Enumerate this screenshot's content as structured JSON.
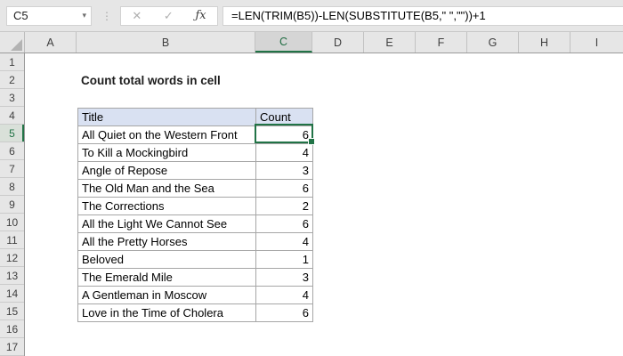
{
  "topbar": {
    "name_box": "C5",
    "formula": "=LEN(TRIM(B5))-LEN(SUBSTITUTE(B5,\" \",\"\"))+1",
    "icons": {
      "dropdown": "▾",
      "dots": "⋮",
      "cancel": "✕",
      "enter": "✓",
      "fx": "ƒx"
    }
  },
  "grid": {
    "columns": [
      "A",
      "B",
      "C",
      "D",
      "E",
      "F",
      "G",
      "H",
      "I"
    ],
    "rows": [
      "1",
      "2",
      "3",
      "4",
      "5",
      "6",
      "7",
      "8",
      "9",
      "10",
      "11",
      "12",
      "13",
      "14",
      "15",
      "16",
      "17"
    ],
    "selected_column": "C",
    "selected_row": "5",
    "selected_cell": "C5"
  },
  "sheet": {
    "title": "Count total words in cell",
    "table": {
      "headers": [
        "Title",
        "Count"
      ],
      "rows": [
        {
          "title": "All Quiet on the Western Front",
          "count": "6"
        },
        {
          "title": "To Kill a Mockingbird",
          "count": "4"
        },
        {
          "title": "Angle of Repose",
          "count": "3"
        },
        {
          "title": "The Old Man and the Sea",
          "count": "6"
        },
        {
          "title": "The Corrections",
          "count": "2"
        },
        {
          "title": "All the Light We Cannot See",
          "count": "6"
        },
        {
          "title": "All the Pretty Horses",
          "count": "4"
        },
        {
          "title": "Beloved",
          "count": "1"
        },
        {
          "title": "The Emerald Mile",
          "count": "3"
        },
        {
          "title": "A Gentleman in Moscow",
          "count": "4"
        },
        {
          "title": "Love in the Time of Cholera",
          "count": "6"
        }
      ]
    }
  },
  "colors": {
    "accent_green": "#217346",
    "header_fill": "#D9E1F2",
    "chrome_gray": "#E6E6E6"
  }
}
